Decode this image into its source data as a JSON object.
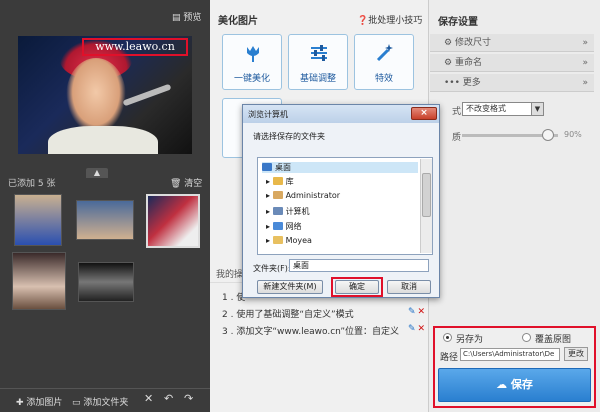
{
  "left": {
    "preview_label": "预览",
    "watermark_text": "www.leawo.cn",
    "added_count": "已添加 5 张",
    "clear_label": "清空",
    "toolbar": {
      "add_image": "添加图片",
      "add_folder": "添加文件夹"
    }
  },
  "middle": {
    "header": "美化图片",
    "tips_link": "批处理小技巧",
    "functions": [
      {
        "label": "一键美化",
        "icon": "tulip-icon"
      },
      {
        "label": "基础调整",
        "icon": "sliders-icon"
      },
      {
        "label": "特效",
        "icon": "magic-wand-icon"
      }
    ],
    "ops_label": "我的操",
    "operations": [
      {
        "index": "1",
        "text": "使"
      },
      {
        "index": "2",
        "text": "使用了基础调整“自定义”模式"
      },
      {
        "index": "3",
        "text": "添加文字“www.leawo.cn”位置：自定义"
      }
    ]
  },
  "right": {
    "header": "保存设置",
    "rows": [
      {
        "label": "修改尺寸",
        "chevron": "»"
      },
      {
        "label": "重命名",
        "chevron": "»"
      },
      {
        "label": "更多",
        "chevron": "»"
      }
    ],
    "format_label": "式",
    "format_value": "不改变格式",
    "quality_label": "质",
    "quality_value": "90%",
    "quality_fraction": 0.9,
    "save_as_label": "另存为",
    "overwrite_label": "覆盖原图",
    "path_label": "路径",
    "path_value": "C:\\Users\\Administrator\\De",
    "change_label": "更改",
    "save_button": "保存"
  },
  "dialog": {
    "title": "浏览计算机",
    "close": "×",
    "prompt": "请选择保存的文件夹",
    "tree": [
      {
        "label": "桌面",
        "icon": "desktop-icon",
        "selected": true
      },
      {
        "label": "库",
        "icon": "library-icon"
      },
      {
        "label": "Administrator",
        "icon": "user-icon"
      },
      {
        "label": "计算机",
        "icon": "computer-icon"
      },
      {
        "label": "网络",
        "icon": "network-icon"
      },
      {
        "label": "Moyea",
        "icon": "folder-icon"
      }
    ],
    "folder_label": "文件夹(F):",
    "folder_value": "桌面",
    "new_folder": "新建文件夹(M)",
    "ok": "确定",
    "cancel": "取消"
  },
  "colors": {
    "accent_blue": "#2a7fd0",
    "highlight_red": "#e0102a"
  }
}
